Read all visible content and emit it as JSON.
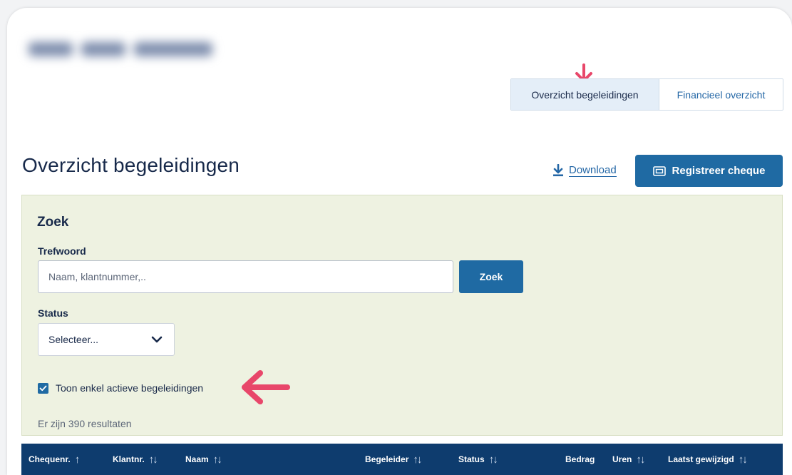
{
  "view_switcher": {
    "active_label": "Overzicht begeleidingen",
    "inactive_label": "Financieel overzicht"
  },
  "page": {
    "title": "Overzicht begeleidingen",
    "download_label": "Download",
    "register_label": "Registreer cheque"
  },
  "search": {
    "heading": "Zoek",
    "keyword_label": "Trefwoord",
    "keyword_value": "",
    "keyword_placeholder": "Naam, klantnummer,..",
    "search_button": "Zoek",
    "status_label": "Status",
    "status_selected": "Selecteer...",
    "active_only_label": "Toon enkel actieve begeleidingen",
    "active_only_checked": true,
    "results_text": "Er zijn 390 resultaten"
  },
  "table": {
    "columns": [
      {
        "label": "Chequenr.",
        "sort": "↑"
      },
      {
        "label": "Klantnr.",
        "sort": "↑↓"
      },
      {
        "label": "Naam",
        "sort": "↑↓"
      },
      {
        "label": "Begeleider",
        "sort": "↑↓"
      },
      {
        "label": "Status",
        "sort": "↑↓"
      },
      {
        "label": "Bedrag",
        "sort": ""
      },
      {
        "label": "Uren",
        "sort": "↑↓"
      },
      {
        "label": "Laatst gewijzigd",
        "sort": "↑↓"
      }
    ]
  },
  "colors": {
    "primary": "#1f6aa3",
    "header_dark": "#0e3c6e",
    "search_bg": "#eef2e1",
    "annotation": "#e8476a"
  },
  "icons": {
    "download": "download-icon",
    "register": "ticket-icon",
    "dropdown": "chevron-down-icon",
    "checkbox": "check-icon",
    "annotation": "arrow-icon"
  }
}
